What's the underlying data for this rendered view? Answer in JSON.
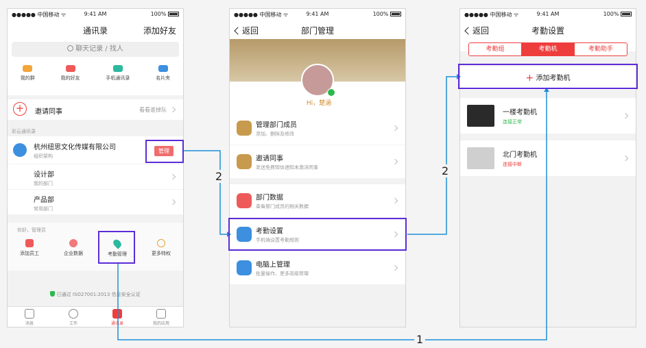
{
  "status_bar": {
    "carrier": "●●●●● 中国移动 ᯤ",
    "time": "9:41 AM",
    "battery": "100%"
  },
  "screen1": {
    "title": "通讯录",
    "add_friend": "添加好友",
    "search_placeholder": "聊天记录 / 找人",
    "quick": [
      "我的群",
      "我的好友",
      "手机通讯录",
      "名片夹"
    ],
    "invite": "邀请同事",
    "invite_hint": "看看谁掉队",
    "section_label": "彩云通讯录",
    "company": "杭州纽思文化传媒有限公司",
    "company_sub": "组织架构",
    "manage_button": "管理",
    "dept1": "设计部",
    "dept1_sub": "我的部门",
    "dept2": "产品部",
    "dept2_sub": "常用部门",
    "greeting": "你好，管理员",
    "tools": [
      "添加员工",
      "企业数据",
      "考勤管理",
      "更多特权"
    ],
    "security": "已通过 ISO27001:2013 信息安全认证",
    "tabs": [
      "消息",
      "工作",
      "通讯录",
      "我的应用"
    ]
  },
  "screen2": {
    "back": "返回",
    "title": "部门管理",
    "greeting": "Hi，楚涵",
    "menu": [
      {
        "title": "管理部门成员",
        "sub": "添加、删除及修改"
      },
      {
        "title": "邀请同事",
        "sub": "发送免费短信通知未激活同事"
      },
      {
        "title": "部门数据",
        "sub": "查看部门成员的相关数据"
      },
      {
        "title": "考勤设置",
        "sub": "手机端设置考勤规则"
      },
      {
        "title": "电脑上管理",
        "sub": "批量操作、更多高级管理"
      }
    ]
  },
  "screen3": {
    "back": "返回",
    "title": "考勤设置",
    "segments": [
      "考勤组",
      "考勤机",
      "考勤助手"
    ],
    "add_device": "添加考勤机",
    "devices": [
      {
        "name": "一楼考勤机",
        "status": "连接正常"
      },
      {
        "name": "北门考勤机",
        "status": "连接中断"
      }
    ]
  },
  "annotations": {
    "step1": "1",
    "step2a": "2",
    "step2b": "2"
  },
  "colors": {
    "accent": "#ee3d3d",
    "highlight": "#5b2bd8",
    "connector": "#1d8fd6",
    "ok": "#2db84d"
  }
}
